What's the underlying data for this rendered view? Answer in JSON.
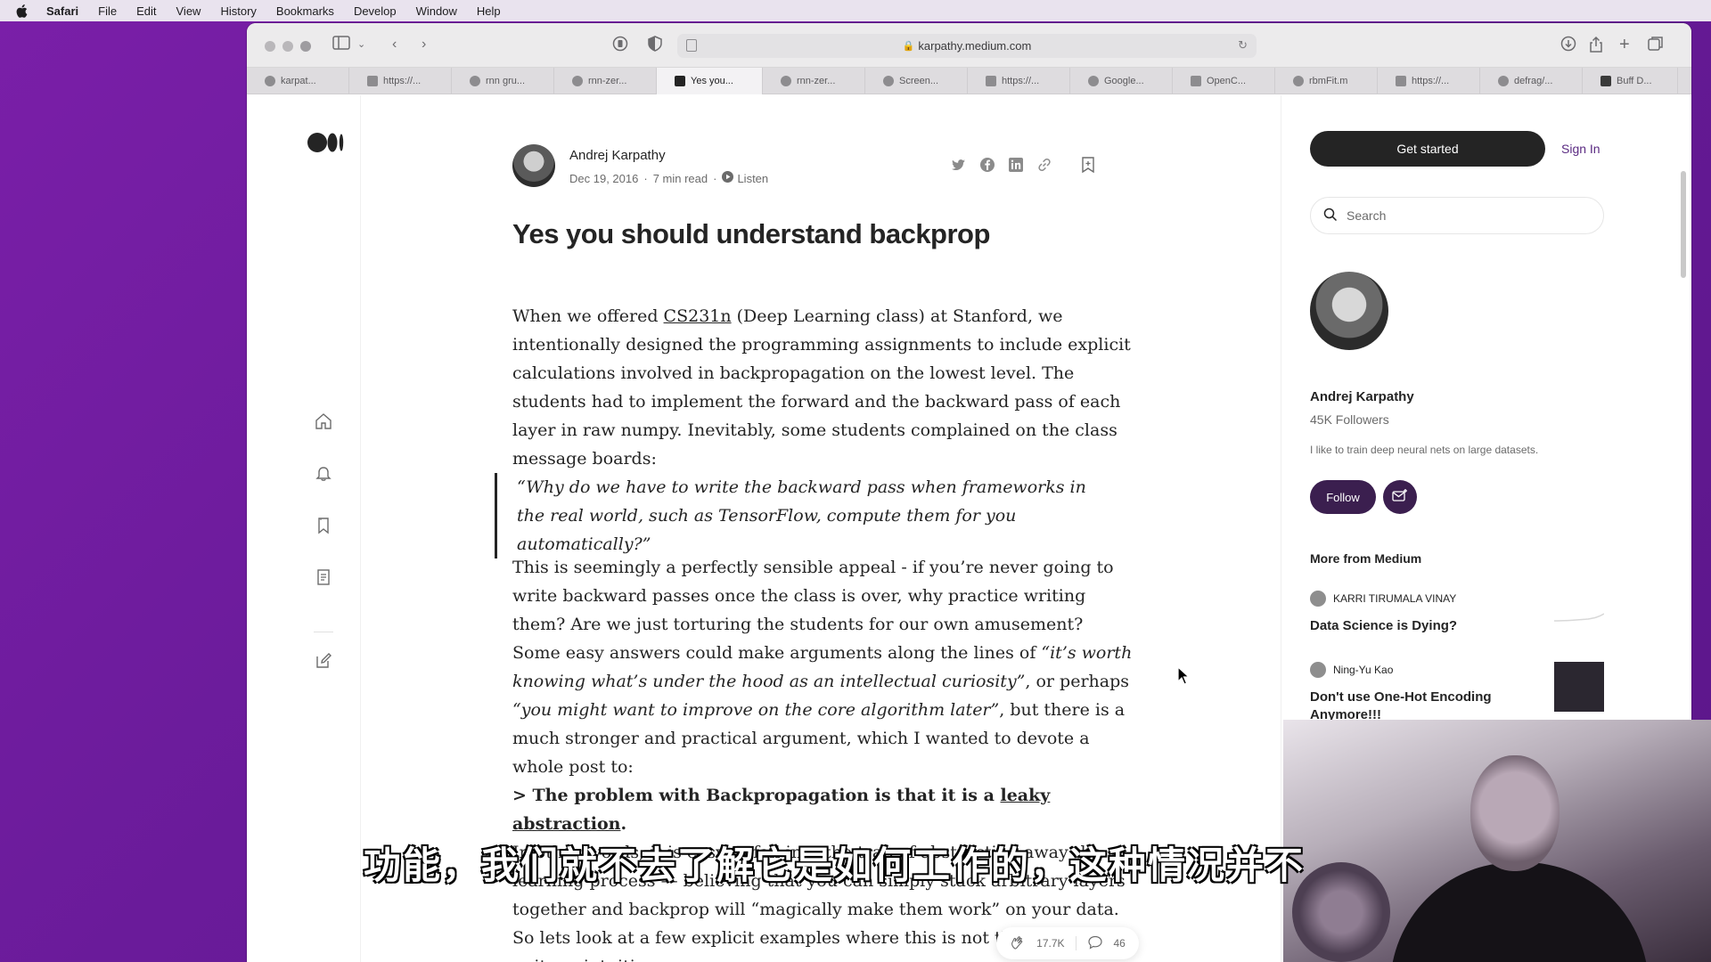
{
  "menubar": {
    "items": [
      "Safari",
      "File",
      "Edit",
      "View",
      "History",
      "Bookmarks",
      "Develop",
      "Window",
      "Help"
    ]
  },
  "browser": {
    "url": "karpathy.medium.com",
    "tabs": [
      {
        "label": "karpat..."
      },
      {
        "label": "https://..."
      },
      {
        "label": "rnn gru..."
      },
      {
        "label": "rnn-zer..."
      },
      {
        "label": "Yes you...",
        "active": true
      },
      {
        "label": "rnn-zer..."
      },
      {
        "label": "Screen..."
      },
      {
        "label": "https://..."
      },
      {
        "label": "Google..."
      },
      {
        "label": "OpenC..."
      },
      {
        "label": "rbmFit.m"
      },
      {
        "label": "https://..."
      },
      {
        "label": "defrag/..."
      },
      {
        "label": "Buff D..."
      }
    ]
  },
  "article": {
    "author": "Andrej Karpathy",
    "date": "Dec 19, 2016",
    "read_time": "7 min read",
    "listen_label": "Listen",
    "title": "Yes you should understand backprop",
    "p1_before_link": "When we offered ",
    "p1_link": "CS231n",
    "p1_after_link": " (Deep Learning class) at Stanford, we intentionally designed the programming assignments to include explicit calculations involved in backpropagation on the lowest level. The students had to implement the forward and the backward pass of each layer in raw numpy. Inevitably, some students complained on the class message boards:",
    "quote": "“Why do we have to write the backward pass when frameworks in the real world, such as TensorFlow, compute them for you automatically?”",
    "p2_a": "This is seemingly a perfectly sensible appeal - if you’re never going to write backward passes once the class is over, why practice writing them? Are we just torturing the students for our own amusement? Some easy answers could make arguments along the lines of ",
    "p2_i1": "“it’s worth knowing what’s under the hood as an intellectual curiosity”",
    "p2_b": ", or perhaps ",
    "p2_i2": "“you might want to improve on the core algorithm later”",
    "p2_c": ", but there is a much stronger and practical argument, which I wanted to devote a whole post to:",
    "p3_before": "> The problem with Backpropagation is that it is a ",
    "p3_link": "leaky abstraction",
    "p3_after": ".",
    "p4": "In other words, it is easy to fall into the trap of abstracting away the learning process — believing that you can simply stack arbitrary layers together and backprop will “magically make them work” on your data. So lets look at a few explicit examples where this is not the case in quite unintuitive ways.",
    "claps": "17.7K",
    "comments": "46"
  },
  "sidebar": {
    "get_started": "Get started",
    "sign_in": "Sign In",
    "search_placeholder": "Search",
    "name": "Andrej Karpathy",
    "followers": "45K Followers",
    "bio": "I like to train deep neural nets on large datasets.",
    "follow": "Follow",
    "more_heading": "More from Medium",
    "recommendations": [
      {
        "author": "KARRI TIRUMALA VINAY",
        "title": "Data Science is Dying?"
      },
      {
        "author": "Ning-Yu Kao",
        "title": "Don't use One-Hot Encoding Anymore!!!"
      }
    ]
  },
  "subtitle": "功能，我们就不去了解它是如何工作的，这种情况并不"
}
